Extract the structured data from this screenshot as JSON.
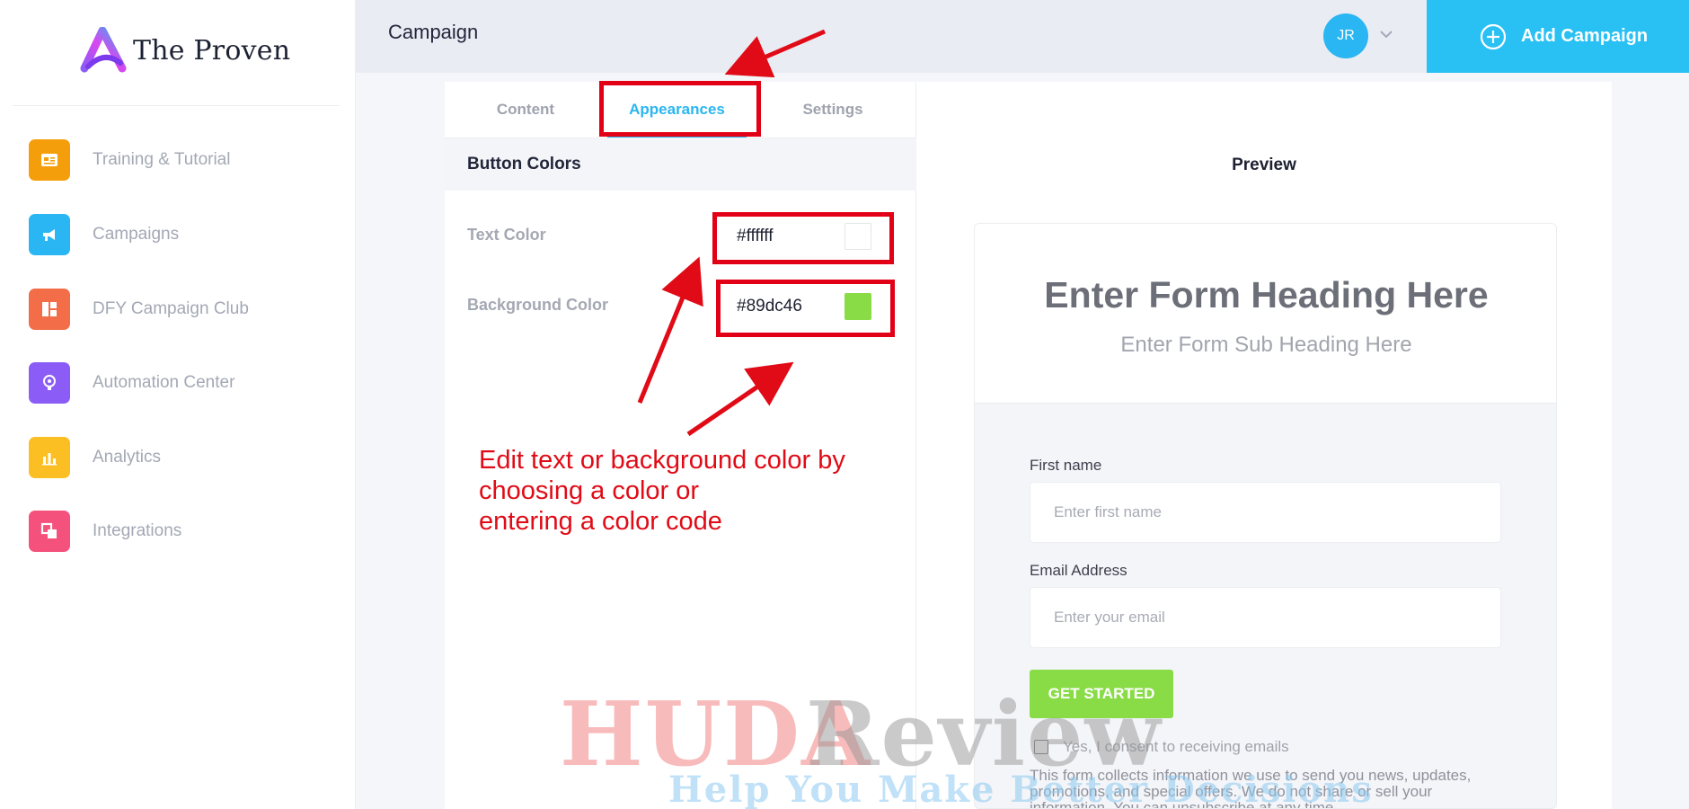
{
  "app": {
    "logo_text": "The Proven",
    "page_title": "Campaign",
    "user_initials": "JR",
    "add_campaign_label": "Add Campaign"
  },
  "sidebar": {
    "items": [
      {
        "label": "Training & Tutorial",
        "icon": "video-card-icon",
        "color": "#f59e0b"
      },
      {
        "label": "Campaigns",
        "icon": "megaphone-icon",
        "color": "#29b6f2"
      },
      {
        "label": "DFY Campaign Club",
        "icon": "layout-grid-icon",
        "color": "#f26d48"
      },
      {
        "label": "Automation Center",
        "icon": "lightbulb-icon",
        "color": "#8b5cf6"
      },
      {
        "label": "Analytics",
        "icon": "bar-chart-icon",
        "color": "#fbbf24"
      },
      {
        "label": "Integrations",
        "icon": "squares-link-icon",
        "color": "#f4517d"
      }
    ]
  },
  "editor": {
    "tabs": [
      "Content",
      "Appearances",
      "Settings"
    ],
    "active_tab": "Appearances",
    "section_title": "Button Colors",
    "text_color_label": "Text Color",
    "text_color_value": "#ffffff",
    "bg_color_label": "Background Color",
    "bg_color_value": "#89dc46"
  },
  "preview": {
    "title": "Preview",
    "form_heading": "Enter Form Heading Here",
    "form_subheading": "Enter Form Sub Heading Here",
    "first_name_label": "First name",
    "first_name_placeholder": "Enter first name",
    "email_label": "Email Address",
    "email_placeholder": "Enter your email",
    "button_label": "GET STARTED",
    "consent_label": "Yes, I consent to receiving emails",
    "disclaimer": "This form collects information we use to send you news, updates, promotions, and special offers. We do not share or sell your information. You can unsubscribe at any time."
  },
  "annotation": {
    "text": "Edit text or background color by\nchoosing a color or\nentering a color code",
    "color": "#e00b16"
  },
  "watermark": {
    "brand_red": "HUDA",
    "brand_gray": "Review",
    "tagline": "Help You Make Better Decisions"
  },
  "colors": {
    "accent": "#29b6f2",
    "button_bg": "#89dc46",
    "button_text": "#ffffff",
    "annotation_red": "#e00b16"
  }
}
